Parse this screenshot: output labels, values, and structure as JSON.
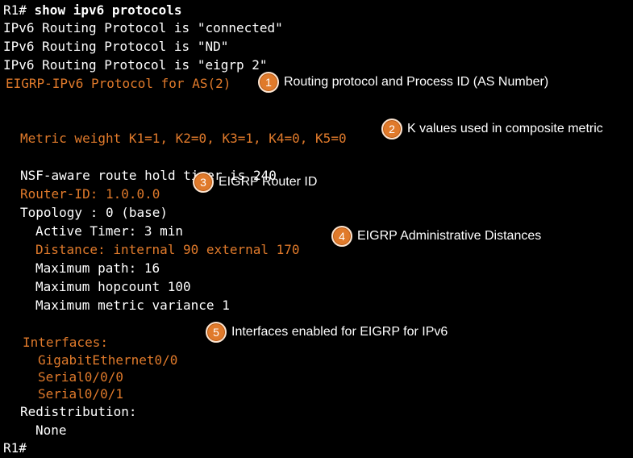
{
  "terminal": {
    "command_prompt": "R1#",
    "command": " show ipv6 protocols",
    "lines": {
      "l1": "IPv6 Routing Protocol is \"connected\"",
      "l2": "IPv6 Routing Protocol is \"ND\"",
      "l3": "IPv6 Routing Protocol is \"eigrp 2\"",
      "l4": "EIGRP-IPv6 Protocol for AS(2)",
      "l5": "Metric weight K1=1, K2=0, K3=1, K4=0, K5=0",
      "l6": "NSF-aware route hold timer is 240",
      "l7": "Router-ID: 1.0.0.0",
      "l8": "Topology : 0 (base)",
      "l9": "Active Timer: 3 min",
      "l10": "Distance: internal 90 external 170",
      "l11": "Maximum path: 16",
      "l12": "Maximum hopcount 100",
      "l13": "Maximum metric variance 1",
      "l14": "Interfaces:",
      "l15": "GigabitEthernet0/0",
      "l16": "Serial0/0/0",
      "l17": "Serial0/0/1",
      "l18": "Redistribution:",
      "l19": "None"
    },
    "end_prompt": "R1#"
  },
  "callouts": [
    {
      "number": "1",
      "text": "Routing protocol and Process ID (AS Number)"
    },
    {
      "number": "2",
      "text": "K values used in composite metric"
    },
    {
      "number": "3",
      "text": "EIGRP Router ID"
    },
    {
      "number": "4",
      "text": "EIGRP Administrative Distances"
    },
    {
      "number": "5",
      "text": "Interfaces enabled for EIGRP for IPv6"
    }
  ],
  "colors": {
    "background": "#000000",
    "text": "#ffffff",
    "highlight": "#e07a2b"
  }
}
